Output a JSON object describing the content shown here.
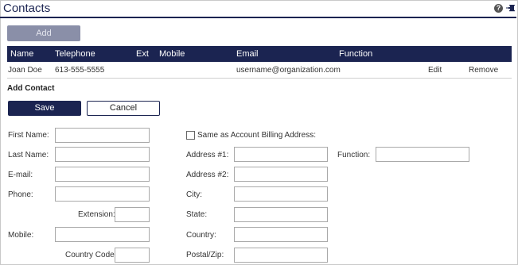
{
  "header": {
    "title": "Contacts",
    "help_icon": "question-circle-icon",
    "pin_icon": "pushpin-icon"
  },
  "toolbar": {
    "add_label": "Add"
  },
  "table": {
    "columns": [
      "Name",
      "Telephone",
      "Ext",
      "Mobile",
      "Email",
      "Function"
    ],
    "rows": [
      {
        "name": "Joan Doe",
        "telephone": "613-555-5555",
        "ext": "",
        "mobile": "",
        "email": "username@organization.com",
        "function": "",
        "edit": "Edit",
        "remove": "Remove"
      }
    ]
  },
  "form": {
    "section_title": "Add Contact",
    "save_label": "Save",
    "cancel_label": "Cancel",
    "same_as_billing_label": "Same as Account Billing Address:",
    "same_as_billing_checked": false,
    "labels": {
      "first_name": "First Name:",
      "last_name": "Last Name:",
      "email": "E-mail:",
      "phone": "Phone:",
      "extension": "Extension:",
      "mobile": "Mobile:",
      "country_code": "Country Code:",
      "address1": "Address #1:",
      "address2": "Address #2:",
      "city": "City:",
      "state": "State:",
      "country": "Country:",
      "postal": "Postal/Zip:",
      "function": "Function:"
    },
    "values": {
      "first_name": "",
      "last_name": "",
      "email": "",
      "phone": "",
      "extension": "",
      "mobile": "",
      "country_code": "",
      "address1": "",
      "address2": "",
      "city": "",
      "state": "",
      "country": "",
      "postal": "",
      "function": ""
    }
  },
  "colors": {
    "accent": "#1b2451",
    "add_disabled": "#8a8fa8"
  }
}
